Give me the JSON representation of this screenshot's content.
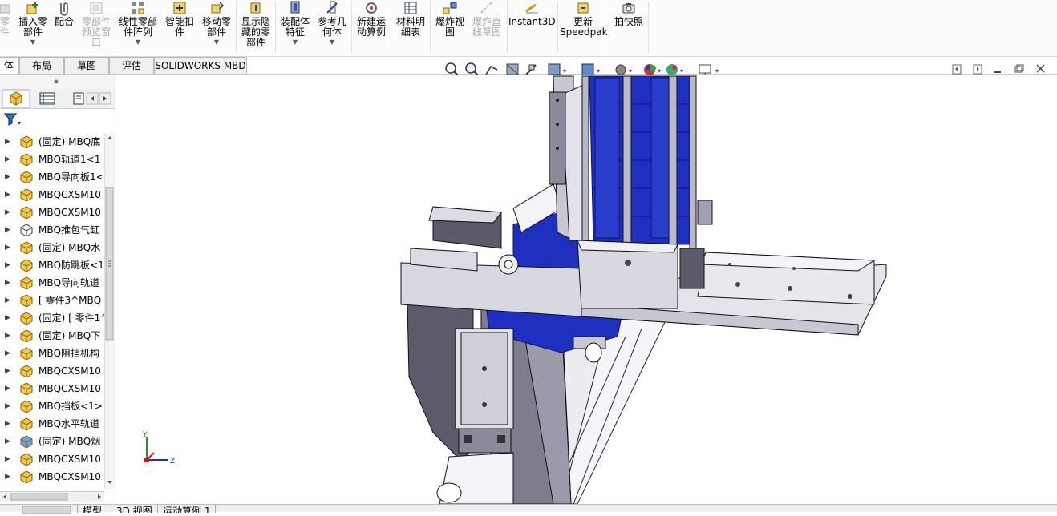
{
  "ribbon": {
    "items": [
      {
        "id": "partial",
        "label": "零\n件",
        "disabled": true
      },
      {
        "id": "insert",
        "label": "插入零\n部件",
        "dropdown": true
      },
      {
        "id": "mate",
        "label": "配合",
        "dropdown": false
      },
      {
        "id": "preview",
        "label": "零部件\n预览窗\n口",
        "disabled": true
      },
      {
        "id": "linear",
        "label": "线性零部\n件阵列",
        "dropdown": true
      },
      {
        "id": "smart",
        "label": "智能扣\n件"
      },
      {
        "id": "move",
        "label": "移动零\n部件",
        "dropdown": true
      },
      {
        "id": "showhide",
        "label": "显示隐\n藏的零\n部件"
      },
      {
        "id": "feature",
        "label": "装配体\n特征",
        "dropdown": true
      },
      {
        "id": "refgeo",
        "label": "参考几\n何体",
        "dropdown": true
      },
      {
        "id": "motion",
        "label": "新建运\n动算例"
      },
      {
        "id": "bom",
        "label": "材料明\n细表"
      },
      {
        "id": "explode",
        "label": "爆炸视\n图"
      },
      {
        "id": "explodeline",
        "label": "爆炸直\n线草图",
        "disabled": true
      },
      {
        "id": "instant3d",
        "label": "Instant3D"
      },
      {
        "id": "speedpak",
        "label": "更新\nSpeedpak"
      },
      {
        "id": "snapshot",
        "label": "拍快照"
      }
    ]
  },
  "tabs": [
    "体",
    "布局",
    "草图",
    "评估",
    "SOLIDWORKS MBD"
  ],
  "tree": {
    "items": [
      {
        "label": "(固定) MBQ底",
        "icon": "part-icon"
      },
      {
        "label": "MBQ轨道1<1",
        "icon": "part-icon"
      },
      {
        "label": "MBQ导向板1<",
        "icon": "part-icon"
      },
      {
        "label": "MBQCXSM10",
        "icon": "part-icon"
      },
      {
        "label": "MBQCXSM10",
        "icon": "part-icon"
      },
      {
        "label": "MBQ推包气缸",
        "icon": "subassembly-icon"
      },
      {
        "label": "(固定) MBQ水",
        "icon": "part-icon"
      },
      {
        "label": "MBQ防跳板<1",
        "icon": "part-icon"
      },
      {
        "label": "MBQ导向轨道",
        "icon": "part-icon"
      },
      {
        "label": "[ 零件3^MBQ",
        "icon": "part-icon"
      },
      {
        "label": "(固定) [ 零件1^",
        "icon": "part-icon"
      },
      {
        "label": "(固定) MBQ下",
        "icon": "part-icon"
      },
      {
        "label": "MBQ阻挡机构",
        "icon": "part-icon"
      },
      {
        "label": "MBQCXSM10",
        "icon": "part-icon"
      },
      {
        "label": "MBQCXSM10",
        "icon": "part-icon"
      },
      {
        "label": "MBQ挡板<1>",
        "icon": "part-icon"
      },
      {
        "label": "MBQ水平轨道",
        "icon": "part-icon"
      },
      {
        "label": "(固定) MBQ烟",
        "icon": "part-icon-blue"
      },
      {
        "label": "MBQCXSM10",
        "icon": "part-icon"
      },
      {
        "label": "MBQCXSM10",
        "icon": "part-icon"
      }
    ]
  },
  "bottom_tabs": [
    "模型",
    "3D 视图",
    "运动算例 1"
  ],
  "triad": {
    "y": "Y",
    "z": "Z"
  },
  "colors": {
    "accent": "#1a2fd0",
    "frame": "#d4d4dc",
    "dark": "#6a6a78"
  }
}
